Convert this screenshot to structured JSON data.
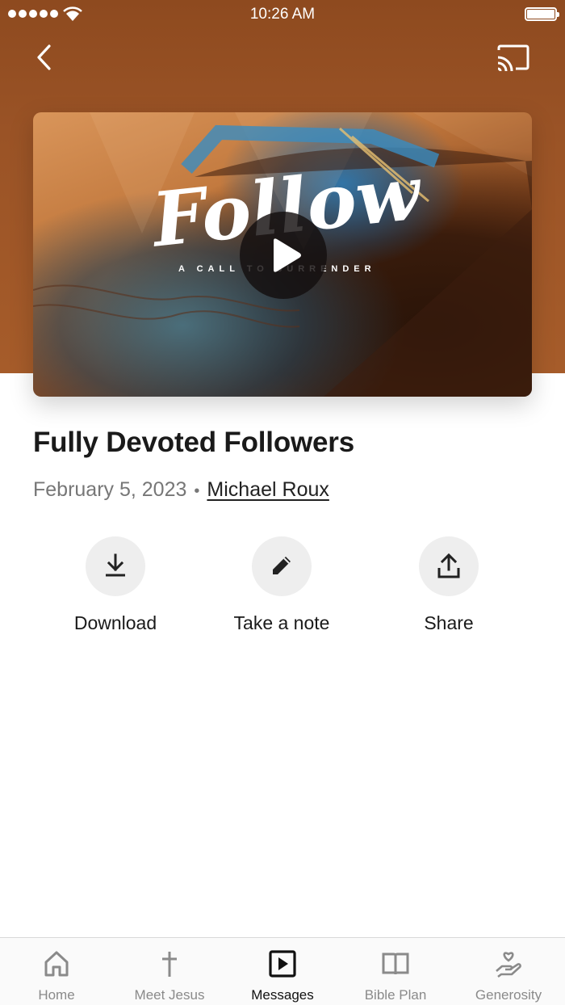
{
  "status_bar": {
    "time": "10:26 AM"
  },
  "colors": {
    "hero": "#9a5326",
    "accent": "#1a1a1a",
    "inactive_tab": "#8a8a8a"
  },
  "header": {
    "back_icon": "chevron-left-icon",
    "cast_icon": "cast-icon"
  },
  "video": {
    "artwork_title": "Follow",
    "artwork_subtitle": "A CALL TO SURRENDER",
    "play_icon": "play-icon"
  },
  "sermon": {
    "title": "Fully Devoted Followers",
    "date": "February 5, 2023",
    "separator": "•",
    "speaker": "Michael Roux"
  },
  "actions": [
    {
      "label": "Download",
      "icon": "download-icon"
    },
    {
      "label": "Take a note",
      "icon": "pencil-icon"
    },
    {
      "label": "Share",
      "icon": "share-icon"
    }
  ],
  "tabs": [
    {
      "label": "Home",
      "icon": "home-icon",
      "active": false
    },
    {
      "label": "Meet Jesus",
      "icon": "cross-icon",
      "active": false
    },
    {
      "label": "Messages",
      "icon": "play-square-icon",
      "active": true
    },
    {
      "label": "Bible Plan",
      "icon": "book-icon",
      "active": false
    },
    {
      "label": "Generosity",
      "icon": "hand-heart-icon",
      "active": false
    }
  ]
}
